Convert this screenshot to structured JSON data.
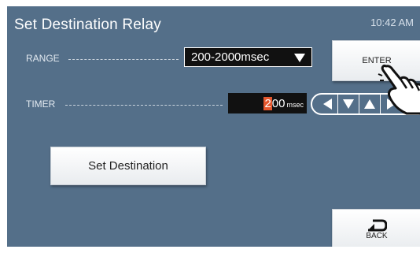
{
  "header": {
    "title": "Set Destination Relay",
    "clock": "10:42 AM"
  },
  "range": {
    "label": "RANGE",
    "selected": "200-2000msec"
  },
  "timer": {
    "label": "TIMER",
    "cursor_digit": "2",
    "rest_digits": "00",
    "unit": "msec"
  },
  "buttons": {
    "enter": "ENTER",
    "set_destination": "Set Destination",
    "back": "BACK"
  },
  "colors": {
    "screen_bg": "#546f89",
    "highlight": "#e4572e"
  }
}
